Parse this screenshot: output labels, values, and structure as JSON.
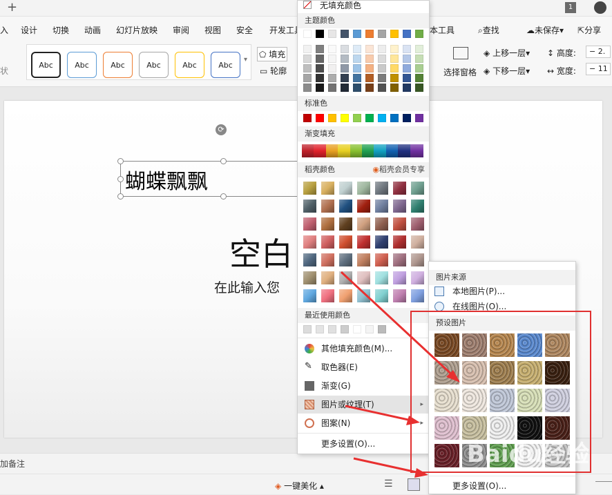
{
  "titlebar": {
    "add_tab": "+",
    "badge": "1"
  },
  "menubar": {
    "tabs": [
      "入",
      "设计",
      "切换",
      "动画",
      "幻灯片放映",
      "审阅",
      "视图",
      "安全",
      "开发工具"
    ],
    "text_tool": "本工具",
    "search": "查找",
    "unsaved": "未保存",
    "share": "分享"
  },
  "ribbon": {
    "styles": [
      "Abc",
      "Abc",
      "Abc",
      "Abc",
      "Abc",
      "Abc"
    ],
    "fill": "填充",
    "outline": "轮廓",
    "selection_pane": "选择窗格",
    "bring_forward": "上移一层",
    "send_backward": "下移一层",
    "height_label": "高度:",
    "width_label": "宽度:",
    "height_value": "2.",
    "width_value": "11",
    "status_left": "状"
  },
  "slide": {
    "textbox_text": "蝴蝶飘飘",
    "title_placeholder": "空白",
    "subtitle_placeholder": "在此输入您"
  },
  "notes": {
    "label": "加备注"
  },
  "statusbar": {
    "beautify": "一键美化"
  },
  "color_menu": {
    "no_fill": "无填充颜色",
    "theme_colors": "主题颜色",
    "standard_colors": "标准色",
    "gradient_fill": "渐变填充",
    "docer_colors": "稻壳颜色",
    "docer_member": "稻壳会员专享",
    "recent_colors": "最近使用颜色",
    "items": [
      "其他填充颜色(M)...",
      "取色器(E)",
      "渐变(G)",
      "图片或纹理(T)",
      "图案(N)",
      "更多设置(O)..."
    ],
    "theme_row": [
      "#ffffff",
      "#000000",
      "#e7e6e6",
      "#44546a",
      "#5b9bd5",
      "#ed7d31",
      "#a5a5a5",
      "#ffc000",
      "#4472c4",
      "#70ad47"
    ],
    "standard_row": [
      "#c00000",
      "#ff0000",
      "#ffc000",
      "#ffff00",
      "#92d050",
      "#00b050",
      "#00b0f0",
      "#0070c0",
      "#002060",
      "#7030a0"
    ],
    "gradient_row": [
      "#c0202a",
      "#e0202a",
      "#e8a020",
      "#e8d020",
      "#88c030",
      "#20a050",
      "#10a0c0",
      "#1060b0",
      "#203080",
      "#7030a0"
    ]
  },
  "picture_menu": {
    "source": "图片来源",
    "local": "本地图片(P)...",
    "online": "在线图片(O)...",
    "presets": "预设图片",
    "more": "更多设置(O)..."
  },
  "watermark": "Baidu经验"
}
